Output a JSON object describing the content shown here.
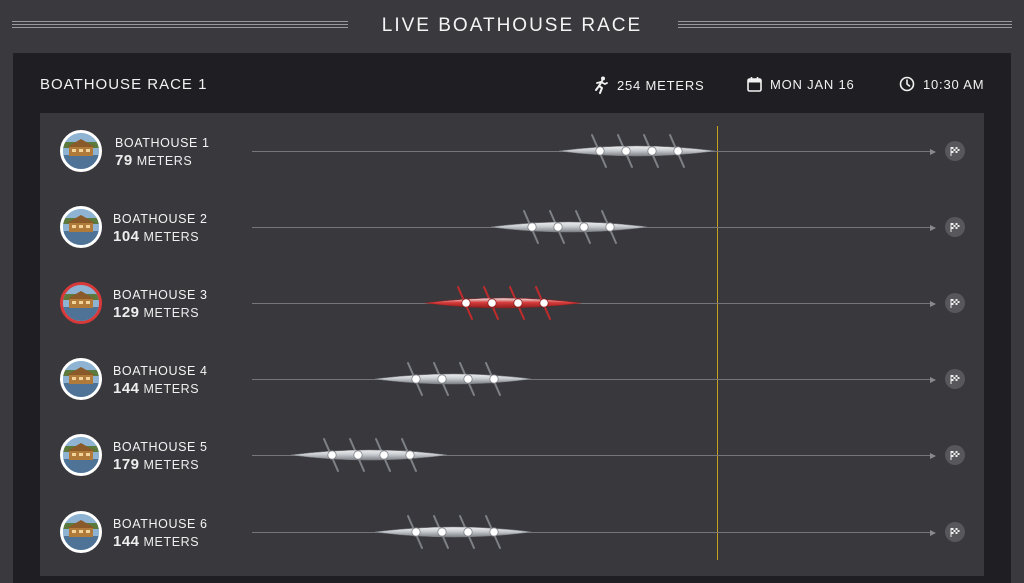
{
  "header": {
    "title": "LIVE BOATHOUSE RACE"
  },
  "race": {
    "title": "BOATHOUSE RACE 1",
    "distance": "254 METERS",
    "date": "MON JAN 16",
    "time": "10:30 AM"
  },
  "icons": {
    "distance": "runner-icon",
    "date": "calendar-icon",
    "time": "clock-icon",
    "finish": "checkered-flag-icon"
  },
  "colors": {
    "selected_boat": "#d83a3a",
    "finish_line": "#c7a11e",
    "panel": "#1f1e22"
  },
  "lanes": [
    {
      "name": "BOATHOUSE 1",
      "distance_value": "79",
      "distance_unit": "METERS",
      "selected": false
    },
    {
      "name": "BOATHOUSE 2",
      "distance_value": "104",
      "distance_unit": "METERS",
      "selected": false
    },
    {
      "name": "BOATHOUSE 3",
      "distance_value": "129",
      "distance_unit": "METERS",
      "selected": true
    },
    {
      "name": "BOATHOUSE 4",
      "distance_value": "144",
      "distance_unit": "METERS",
      "selected": false
    },
    {
      "name": "BOATHOUSE 5",
      "distance_value": "179",
      "distance_unit": "METERS",
      "selected": false
    },
    {
      "name": "BOATHOUSE 6",
      "distance_value": "144",
      "distance_unit": "METERS",
      "selected": false
    }
  ]
}
